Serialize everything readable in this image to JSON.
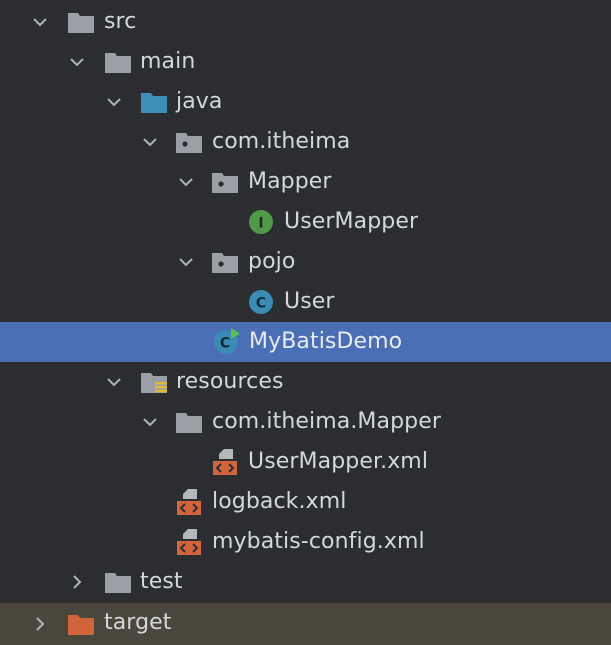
{
  "tree": {
    "src": "src",
    "main": "main",
    "java": "java",
    "package": "com.itheima",
    "mapper_pkg": "Mapper",
    "user_mapper": "UserMapper",
    "pojo": "pojo",
    "user": "User",
    "mybatis_demo": "MyBatisDemo",
    "resources": "resources",
    "res_mapper_pkg": "com.itheima.Mapper",
    "user_mapper_xml": "UserMapper.xml",
    "logback_xml": "logback.xml",
    "mybatis_config_xml": "mybatis-config.xml",
    "test": "test",
    "target": "target"
  },
  "icons": {
    "interface_badge": "I",
    "class_badge": "C"
  },
  "colors": {
    "selection": "#4a6fb5",
    "excluded_row": "#4a463c",
    "folder_grey": "#9aa0a6",
    "source_folder": "#3d8fb7",
    "excluded_folder": "#d2643c",
    "interface_green": "#4f9a48",
    "class_blue": "#3a8bb5",
    "xml_orange": "#d2643c"
  }
}
